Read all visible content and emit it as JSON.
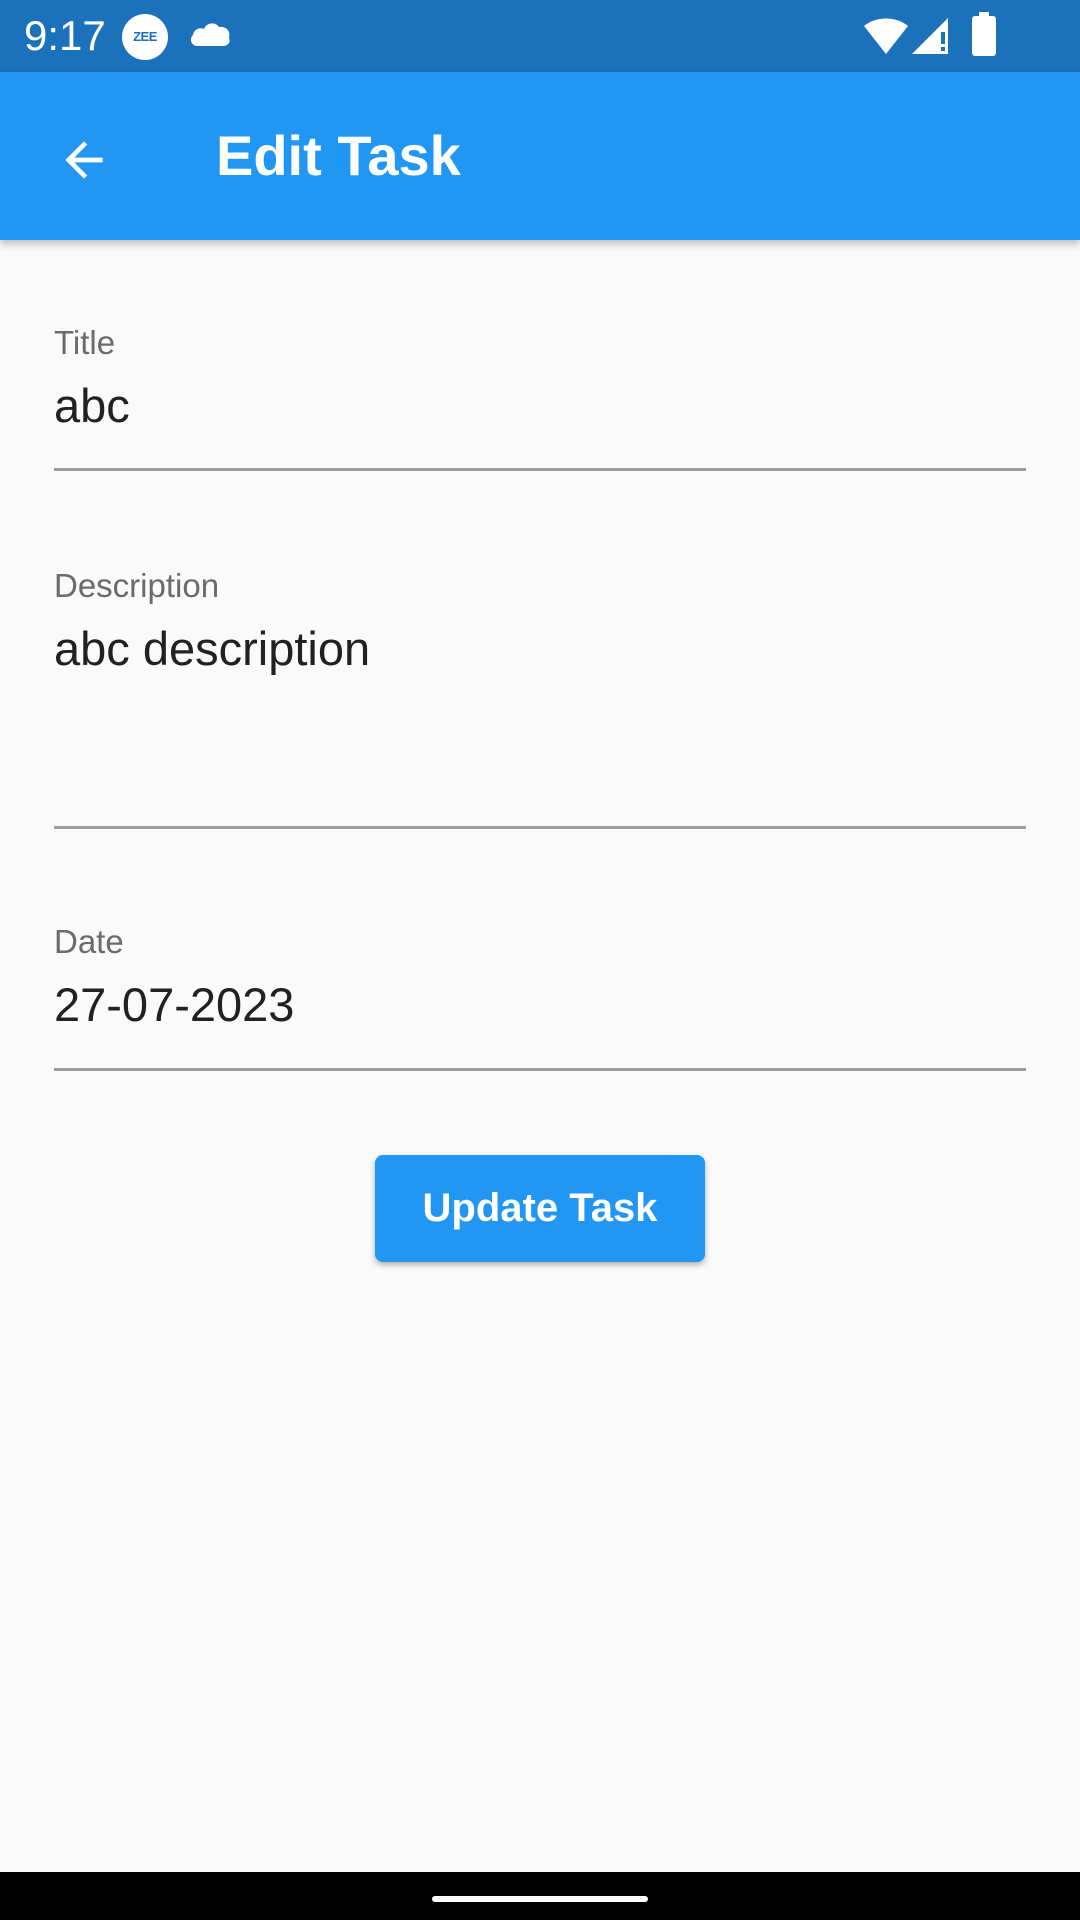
{
  "status_bar": {
    "time": "9:17",
    "notification_badge": "ZEE",
    "icons": [
      "zee-news-icon",
      "cloud-icon",
      "wifi-icon",
      "signal-icon",
      "battery-icon"
    ]
  },
  "app_bar": {
    "title": "Edit Task",
    "back_icon": "arrow-back-icon",
    "color": "#2196f3"
  },
  "form": {
    "title": {
      "label": "Title",
      "value": "abc"
    },
    "description": {
      "label": "Description",
      "value": "abc description"
    },
    "date": {
      "label": "Date",
      "value": "27-07-2023"
    }
  },
  "actions": {
    "update_label": "Update Task"
  },
  "colors": {
    "status_bar": "#1b72bb",
    "primary": "#2196f3",
    "background": "#fafafa",
    "text": "#212121",
    "label": "#6b6b6b",
    "underline": "#9e9e9e"
  }
}
